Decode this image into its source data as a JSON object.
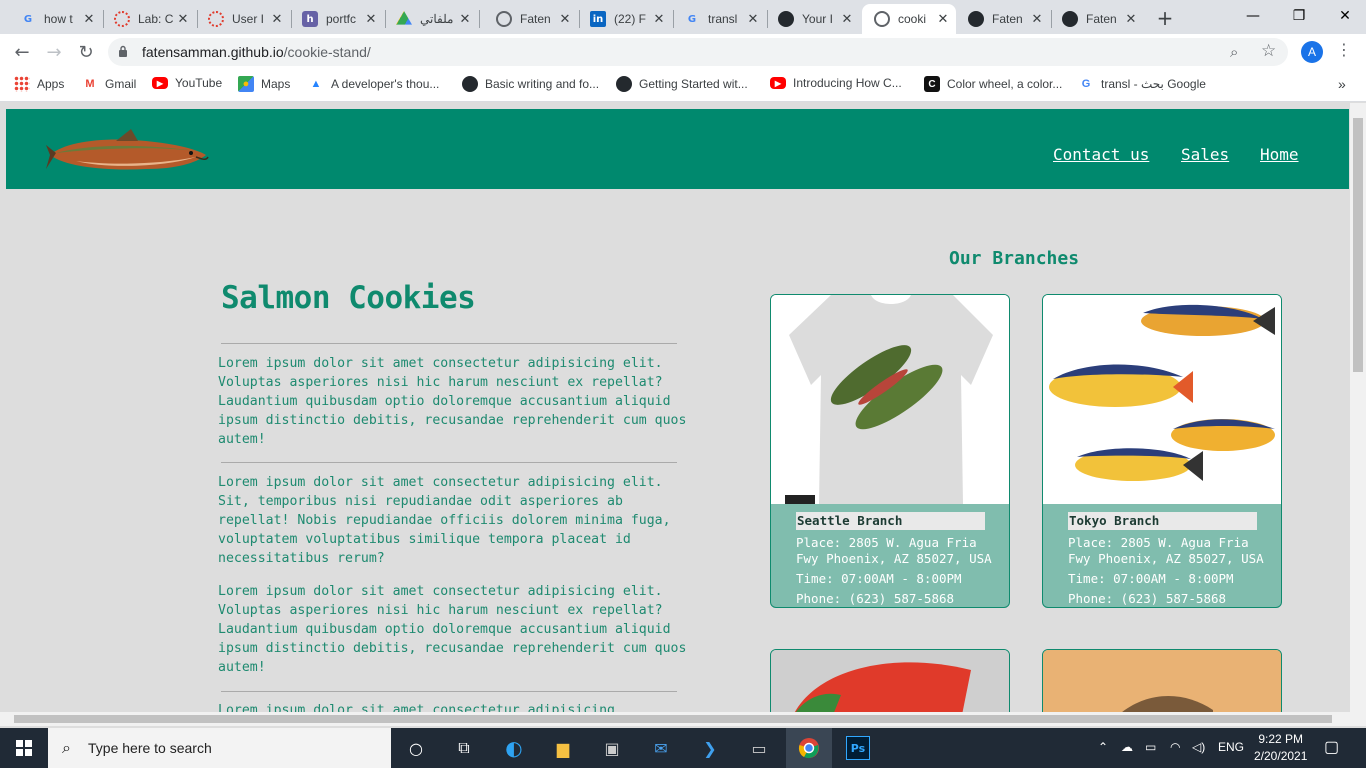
{
  "browser": {
    "tabs": [
      {
        "title": "how t",
        "icon": "google-icon"
      },
      {
        "title": "Lab: C",
        "icon": "canvas-icon"
      },
      {
        "title": "User I",
        "icon": "canvas-icon"
      },
      {
        "title": "portfc",
        "icon": "heroku-icon"
      },
      {
        "title": "ملفاتي",
        "icon": "google-drive-icon"
      },
      {
        "title": "Faten",
        "icon": "globe-icon"
      },
      {
        "title": "(22) F",
        "icon": "linkedin-icon"
      },
      {
        "title": "transl",
        "icon": "google-icon"
      },
      {
        "title": "Your I",
        "icon": "github-icon"
      },
      {
        "title": "cooki",
        "icon": "globe-icon",
        "active": true
      },
      {
        "title": "Faten",
        "icon": "github-icon"
      },
      {
        "title": "Faten",
        "icon": "github-icon"
      }
    ],
    "url_host": "fatensamman.github.io",
    "url_path": "/cookie-stand/",
    "profile_initial": "A",
    "bookmarks": [
      {
        "label": "Apps",
        "icon": "apps-grid-icon"
      },
      {
        "label": "Gmail",
        "icon": "gmail-icon"
      },
      {
        "label": "YouTube",
        "icon": "youtube-icon"
      },
      {
        "label": "Maps",
        "icon": "maps-icon"
      },
      {
        "label": "A developer's thou...",
        "icon": "atlassian-icon"
      },
      {
        "label": "Basic writing and fo...",
        "icon": "github-icon"
      },
      {
        "label": "Getting Started wit...",
        "icon": "github-icon"
      },
      {
        "label": "Introducing How C...",
        "icon": "youtube-icon"
      },
      {
        "label": "Color wheel, a color...",
        "icon": "canva-icon"
      },
      {
        "label": "transl - بحث Google",
        "icon": "google-icon"
      }
    ]
  },
  "site": {
    "nav": {
      "contact": "Contact us",
      "sales": "Sales",
      "home": "Home"
    },
    "title": "Salmon Cookies",
    "paragraphs": [
      "Lorem ipsum dolor sit amet consectetur adipisicing elit. Voluptas asperiores nisi hic harum nesciunt ex repellat? Laudantium quibusdam optio doloremque accusantium aliquid ipsum distinctio debitis, recusandae reprehenderit cum quos autem!",
      "Lorem ipsum dolor sit amet consectetur adipisicing elit. Sit, temporibus nisi repudiandae odit asperiores ab repellat! Nobis repudiandae officiis dolorem minima fuga, voluptatem voluptatibus similique tempora placeat id necessitatibus rerum?",
      "Lorem ipsum dolor sit amet consectetur adipisicing elit. Voluptas asperiores nisi hic harum nesciunt ex repellat? Laudantium quibusdam optio doloremque accusantium aliquid ipsum distinctio debitis, recusandae reprehenderit cum quos autem!",
      "Lorem ipsum dolor sit amet consectetur adipisicing"
    ],
    "branches_title": "Our Branches",
    "branches": [
      {
        "name": "Seattle Branch",
        "place": "Place: 2805 W. Agua Fria Fwy Phoenix, AZ 85027, USA",
        "time": "Time: 07:00AM - 8:00PM",
        "phone": "Phone: (623) 587-5868"
      },
      {
        "name": "Tokyo Branch",
        "place": "Place: 2805 W. Agua Fria Fwy Phoenix, AZ 85027, USA",
        "time": "Time: 07:00AM - 8:00PM",
        "phone": "Phone: (623) 587-5868"
      }
    ]
  },
  "taskbar": {
    "search_placeholder": "Type here to search",
    "language": "ENG",
    "time": "9:22 PM",
    "date": "2/20/2021"
  }
}
